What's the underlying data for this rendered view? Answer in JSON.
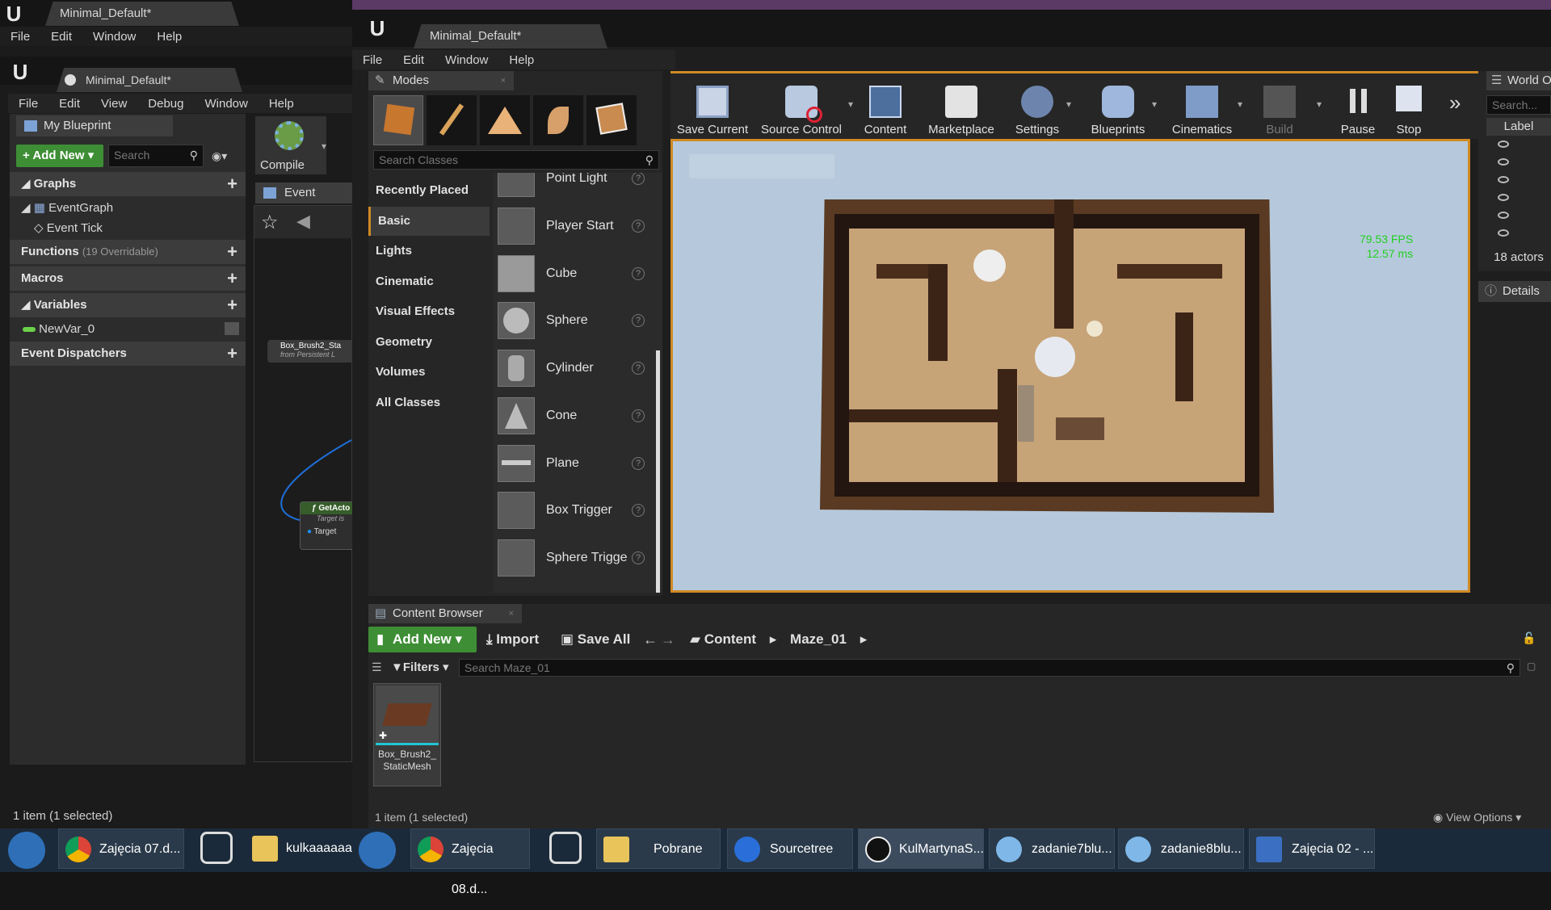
{
  "left_window": {
    "title": "Minimal_Default*",
    "menu": [
      "File",
      "Edit",
      "Window",
      "Help"
    ]
  },
  "blueprint_editor": {
    "tab_title": "Minimal_Default*",
    "menu": [
      "File",
      "Edit",
      "View",
      "Debug",
      "Window",
      "Help"
    ],
    "my_blueprint_tab": "My Blueprint",
    "add_new_label": "Add New",
    "search_placeholder": "Search",
    "compile_label": "Compile",
    "event_graph_tab": "Event Graph",
    "sections": {
      "graphs": "Graphs",
      "event_graph": "EventGraph",
      "event_tick": "Event Tick",
      "functions": "Functions",
      "functions_note": "(19 Overridable)",
      "macros": "Macros",
      "variables": "Variables",
      "new_var": "NewVar_0",
      "event_dispatchers": "Event Dispatchers"
    },
    "graph_nodes": {
      "box_node_title": "Box_Brush2_Sta",
      "box_node_sub": "from Persistent L",
      "get_actor_title": "GetActo",
      "get_actor_sub": "Target is",
      "target_pin": "Target"
    },
    "status": "1 item (1 selected)"
  },
  "main_editor": {
    "title": "Minimal_Default*",
    "menu": [
      "File",
      "Edit",
      "Window",
      "Help"
    ],
    "modes_tab": "Modes",
    "search_classes_placeholder": "Search Classes",
    "categories": [
      "Recently Placed",
      "Basic",
      "Lights",
      "Cinematic",
      "Visual Effects",
      "Geometry",
      "Volumes",
      "All Classes"
    ],
    "selected_category": "Basic",
    "items": [
      "Point Light",
      "Player Start",
      "Cube",
      "Sphere",
      "Cylinder",
      "Cone",
      "Plane",
      "Box Trigger",
      "Sphere Trigge"
    ],
    "toolbar": {
      "save_current": "Save Current",
      "source_control": "Source Control",
      "content": "Content",
      "marketplace": "Marketplace",
      "settings": "Settings",
      "blueprints": "Blueprints",
      "cinematics": "Cinematics",
      "build": "Build",
      "pause": "Pause",
      "stop": "Stop"
    },
    "viewport": {
      "fps": "79.53 FPS",
      "ms": "12.57 ms"
    },
    "world_outliner": {
      "title": "World O",
      "search_placeholder": "Search...",
      "label_header": "Label",
      "actors_count": "18 actors",
      "details_tab": "Details"
    },
    "content_browser": {
      "tab": "Content Browser",
      "add_new": "Add New",
      "import": "Import",
      "save_all": "Save All",
      "path": [
        "Content",
        "Maze_01"
      ],
      "filters": "Filters",
      "search_placeholder": "Search Maze_01",
      "asset_name": "Box_Brush2_ StaticMesh",
      "status": "1 item (1 selected)",
      "view_options": "View Options"
    }
  },
  "taskbar": {
    "items": [
      "Zajęcia 07.d...",
      "kulkaaaaaa",
      "Zajęcia 08.d...",
      "Pobrane",
      "Sourcetree",
      "KulMartynaS...",
      "zadanie7blu...",
      "zadanie8blu...",
      "Zajęcia 02 - ..."
    ]
  },
  "colors": {
    "accent_green": "#3e8e35",
    "fps_green": "#22d022",
    "viewport_bg": "#b6c9dc",
    "selection_orange": "#d08a24"
  }
}
